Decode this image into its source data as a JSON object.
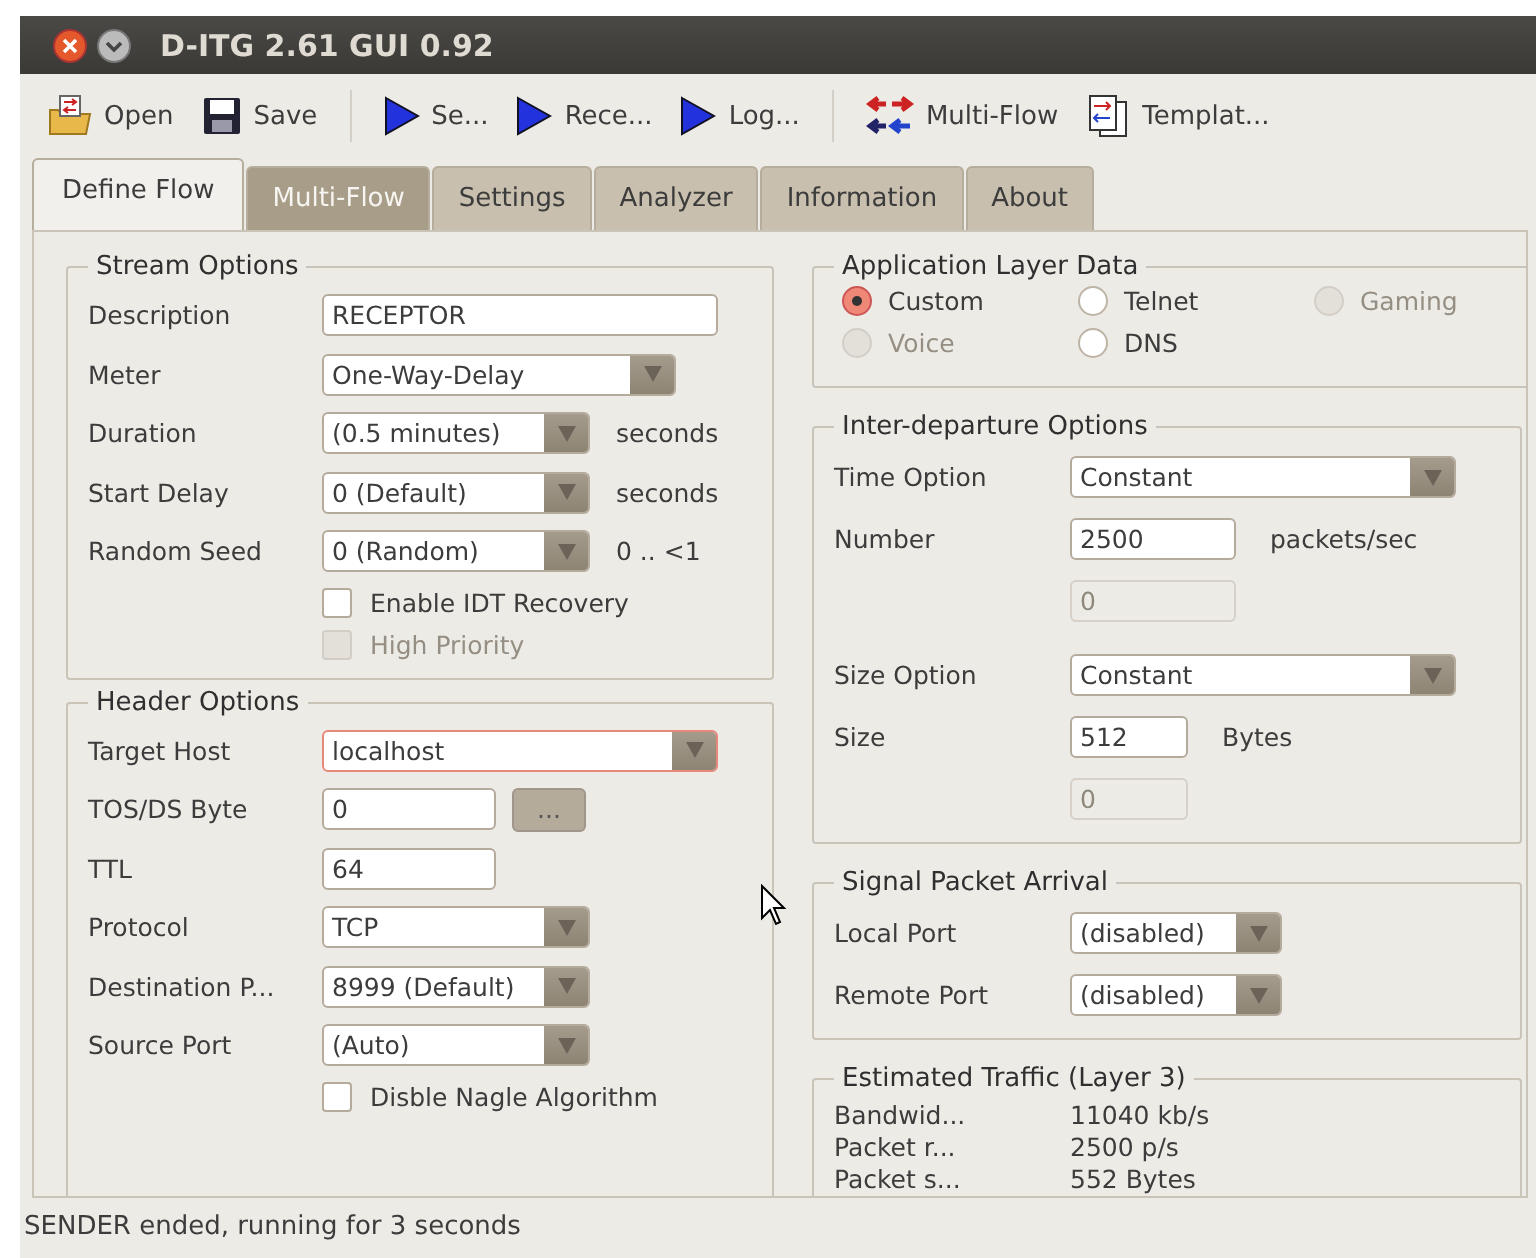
{
  "window": {
    "title": "D-ITG 2.61 GUI 0.92"
  },
  "toolbar": {
    "groups": [
      [
        {
          "label": "Open",
          "kind": "open"
        },
        {
          "label": "Save",
          "kind": "save"
        }
      ],
      [
        {
          "label": "Se...",
          "kind": "play"
        },
        {
          "label": "Rece...",
          "kind": "play"
        },
        {
          "label": "Log...",
          "kind": "play"
        }
      ],
      [
        {
          "label": "Multi-Flow",
          "kind": "multiflow"
        },
        {
          "label": "Templat...",
          "kind": "template"
        }
      ]
    ]
  },
  "tabs": [
    {
      "label": "Define Flow",
      "selected": true,
      "disabled": false
    },
    {
      "label": "Multi-Flow",
      "selected": false,
      "disabled": true
    },
    {
      "label": "Settings",
      "selected": false,
      "disabled": false
    },
    {
      "label": "Analyzer",
      "selected": false,
      "disabled": false
    },
    {
      "label": "Information",
      "selected": false,
      "disabled": false
    },
    {
      "label": "About",
      "selected": false,
      "disabled": false
    }
  ],
  "stream_options": {
    "title": "Stream Options",
    "rows": [
      {
        "kind": "text",
        "label": "Description",
        "value": "RECEPTOR"
      },
      {
        "kind": "combo",
        "label": "Meter",
        "value": "One-Way-Delay"
      },
      {
        "kind": "combo",
        "label": "Duration",
        "value": "(0.5 minutes)",
        "unit": "seconds"
      },
      {
        "kind": "combo",
        "label": "Start Delay",
        "value": "0 (Default)",
        "unit": "seconds"
      },
      {
        "kind": "combo",
        "label": "Random Seed",
        "value": "0 (Random)",
        "unit": "0 .. <1"
      }
    ],
    "checkboxes": [
      {
        "label": "Enable IDT Recovery",
        "checked": false,
        "disabled": false
      },
      {
        "label": "High Priority",
        "checked": false,
        "disabled": true
      }
    ]
  },
  "header_options": {
    "title": "Header Options",
    "rows": [
      {
        "kind": "combo",
        "label": "Target Host",
        "value": "localhost",
        "highlighted": true
      },
      {
        "kind": "text_button",
        "label": "TOS/DS Byte",
        "value": "0",
        "button": "..."
      },
      {
        "kind": "text",
        "label": "TTL",
        "value": "64"
      },
      {
        "kind": "combo",
        "label": "Protocol",
        "value": "TCP"
      },
      {
        "kind": "combo",
        "label": "Destination P...",
        "value": "8999 (Default)"
      },
      {
        "kind": "combo",
        "label": "Source Port",
        "value": "(Auto)"
      }
    ],
    "checkboxes": [
      {
        "label": "Disble Nagle Algorithm",
        "checked": false,
        "disabled": false
      }
    ]
  },
  "application_layer": {
    "title": "Application Layer Data",
    "options": [
      {
        "label": "Custom",
        "selected": true,
        "disabled": false
      },
      {
        "label": "Telnet",
        "selected": false,
        "disabled": false
      },
      {
        "label": "Gaming",
        "selected": false,
        "disabled": true
      },
      {
        "label": "Voice",
        "selected": false,
        "disabled": true
      },
      {
        "label": "DNS",
        "selected": false,
        "disabled": false
      }
    ]
  },
  "inter_departure": {
    "title": "Inter-departure Options",
    "rows": [
      {
        "kind": "combo",
        "label": "Time Option",
        "value": "Constant"
      },
      {
        "kind": "text",
        "label": "Number",
        "value": "2500",
        "unit": "packets/sec"
      },
      {
        "kind": "disabled_text",
        "value": "0"
      },
      {
        "kind": "combo",
        "label": "Size Option",
        "value": "Constant"
      },
      {
        "kind": "text",
        "label": "Size",
        "value": "512",
        "unit": "Bytes"
      },
      {
        "kind": "disabled_text",
        "value": "0"
      }
    ]
  },
  "signal_packet_arrival": {
    "title": "Signal Packet Arrival",
    "rows": [
      {
        "kind": "combo",
        "label": "Local Port",
        "value": "(disabled)"
      },
      {
        "kind": "combo",
        "label": "Remote Port",
        "value": "(disabled)"
      }
    ]
  },
  "estimated_traffic": {
    "title": "Estimated Traffic (Layer 3)",
    "rows": [
      {
        "label": "Bandwid...",
        "value": "11040 kb/s"
      },
      {
        "label": "Packet r...",
        "value": "2500 p/s"
      },
      {
        "label": "Packet s...",
        "value": "552 Bytes"
      }
    ]
  },
  "status_bar": {
    "text": "SENDER ended, running for 3 seconds"
  }
}
